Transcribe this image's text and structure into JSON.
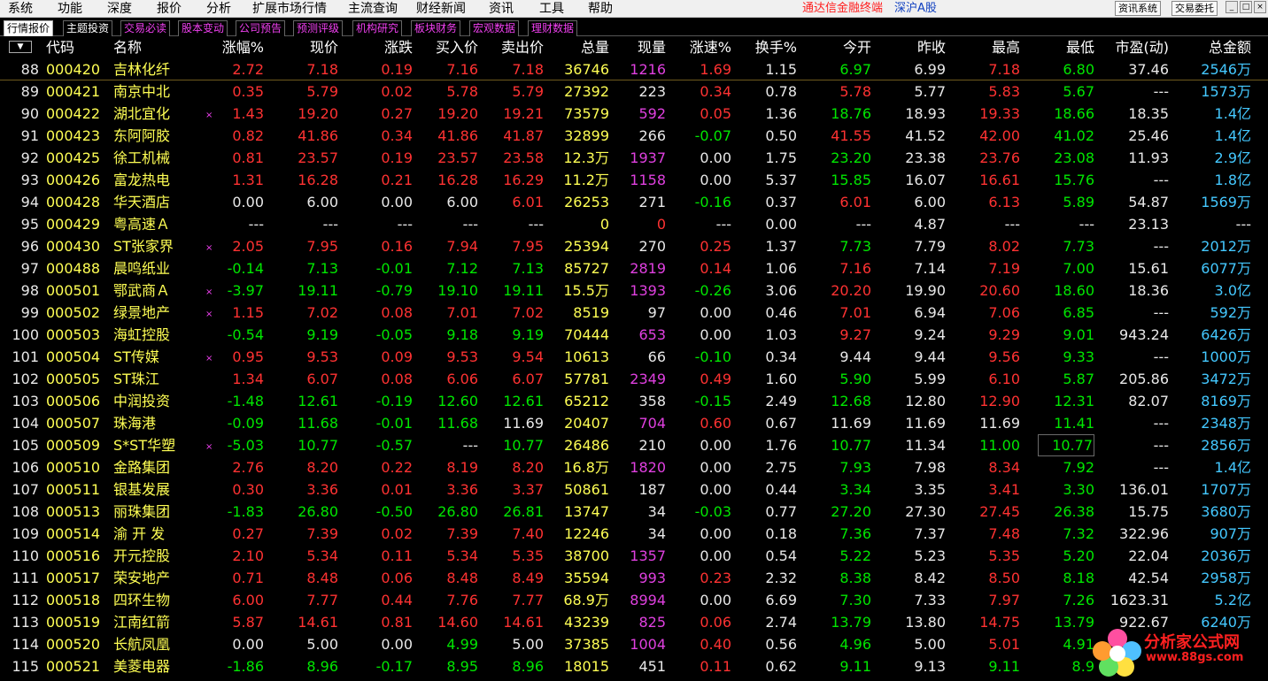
{
  "menu": {
    "items": [
      "系统",
      "功能",
      "深度",
      "报价",
      "分析",
      "扩展市场行情",
      "主流查询",
      "财经新闻",
      "资讯",
      "工具",
      "帮助"
    ],
    "app_status": "通达信金融终端",
    "market": "深沪A股",
    "buttons": [
      "资讯系统",
      "交易委托"
    ],
    "window_controls": [
      "_",
      "□",
      "×"
    ]
  },
  "tabs": [
    "行情报价",
    "主题投资",
    "交易必读",
    "股本变动",
    "公司预告",
    "预测评级",
    "机构研究",
    "板块财务",
    "宏观数据",
    "理财数据"
  ],
  "header": {
    "sort_icon": "▼",
    "columns": [
      "代码",
      "名称",
      "涨幅%",
      "现价",
      "涨跌",
      "买入价",
      "卖出价",
      "总量",
      "现量",
      "涨速%",
      "换手%",
      "今开",
      "昨收",
      "最高",
      "最低",
      "市盈(动)",
      "总金额"
    ]
  },
  "colors": {
    "up": "#ff3232",
    "down": "#00e600",
    "flat": "#e8e8e8",
    "code": "#ffff54",
    "amount": "#44c8ff",
    "volume_highlight": "#e040e0"
  },
  "rows": [
    {
      "idx": "88",
      "code": "000420",
      "name": "吉林化纤",
      "mark": false,
      "chg_pct": "2.72",
      "price": "7.18",
      "change": "0.19",
      "bid": "7.16",
      "ask": "7.18",
      "vol": "36746",
      "cur_vol": "1216",
      "speed": "1.69",
      "turnover": "1.15",
      "open": "6.97",
      "prev_close": "6.99",
      "high": "7.18",
      "low": "6.80",
      "pe": "37.46",
      "amount": "2546万"
    },
    {
      "idx": "89",
      "code": "000421",
      "name": "南京中北",
      "mark": false,
      "chg_pct": "0.35",
      "price": "5.79",
      "change": "0.02",
      "bid": "5.78",
      "ask": "5.79",
      "vol": "27392",
      "cur_vol": "223",
      "speed": "0.34",
      "turnover": "0.78",
      "open": "5.78",
      "prev_close": "5.77",
      "high": "5.83",
      "low": "5.67",
      "pe": "---",
      "amount": "1573万"
    },
    {
      "idx": "90",
      "code": "000422",
      "name": "湖北宜化",
      "mark": true,
      "chg_pct": "1.43",
      "price": "19.20",
      "change": "0.27",
      "bid": "19.20",
      "ask": "19.21",
      "vol": "73579",
      "cur_vol": "592",
      "speed": "0.05",
      "turnover": "1.36",
      "open": "18.76",
      "prev_close": "18.93",
      "high": "19.33",
      "low": "18.66",
      "pe": "18.35",
      "amount": "1.4亿"
    },
    {
      "idx": "91",
      "code": "000423",
      "name": "东阿阿胶",
      "mark": false,
      "chg_pct": "0.82",
      "price": "41.86",
      "change": "0.34",
      "bid": "41.86",
      "ask": "41.87",
      "vol": "32899",
      "cur_vol": "266",
      "speed": "-0.07",
      "turnover": "0.50",
      "open": "41.55",
      "prev_close": "41.52",
      "high": "42.00",
      "low": "41.02",
      "pe": "25.46",
      "amount": "1.4亿"
    },
    {
      "idx": "92",
      "code": "000425",
      "name": "徐工机械",
      "mark": false,
      "chg_pct": "0.81",
      "price": "23.57",
      "change": "0.19",
      "bid": "23.57",
      "ask": "23.58",
      "vol": "12.3万",
      "cur_vol": "1937",
      "speed": "0.00",
      "turnover": "1.75",
      "open": "23.20",
      "prev_close": "23.38",
      "high": "23.76",
      "low": "23.08",
      "pe": "11.93",
      "amount": "2.9亿"
    },
    {
      "idx": "93",
      "code": "000426",
      "name": "富龙热电",
      "mark": false,
      "chg_pct": "1.31",
      "price": "16.28",
      "change": "0.21",
      "bid": "16.28",
      "ask": "16.29",
      "vol": "11.2万",
      "cur_vol": "1158",
      "speed": "0.00",
      "turnover": "5.37",
      "open": "15.85",
      "prev_close": "16.07",
      "high": "16.61",
      "low": "15.76",
      "pe": "---",
      "amount": "1.8亿"
    },
    {
      "idx": "94",
      "code": "000428",
      "name": "华天酒店",
      "mark": false,
      "chg_pct": "0.00",
      "price": "6.00",
      "change": "0.00",
      "bid": "6.00",
      "ask": "6.01",
      "vol": "26253",
      "cur_vol": "271",
      "speed": "-0.16",
      "turnover": "0.37",
      "open": "6.01",
      "prev_close": "6.00",
      "high": "6.13",
      "low": "5.89",
      "pe": "54.87",
      "amount": "1569万"
    },
    {
      "idx": "95",
      "code": "000429",
      "name": "粤高速Ａ",
      "mark": false,
      "chg_pct": "---",
      "price": "---",
      "change": "---",
      "bid": "---",
      "ask": "---",
      "vol": "0",
      "cur_vol": "0",
      "speed": "---",
      "turnover": "0.00",
      "open": "---",
      "prev_close": "4.87",
      "high": "---",
      "low": "---",
      "pe": "23.13",
      "amount": "---"
    },
    {
      "idx": "96",
      "code": "000430",
      "name": "ST张家界",
      "mark": true,
      "chg_pct": "2.05",
      "price": "7.95",
      "change": "0.16",
      "bid": "7.94",
      "ask": "7.95",
      "vol": "25394",
      "cur_vol": "270",
      "speed": "0.25",
      "turnover": "1.37",
      "open": "7.73",
      "prev_close": "7.79",
      "high": "8.02",
      "low": "7.73",
      "pe": "---",
      "amount": "2012万"
    },
    {
      "idx": "97",
      "code": "000488",
      "name": "晨鸣纸业",
      "mark": false,
      "chg_pct": "-0.14",
      "price": "7.13",
      "change": "-0.01",
      "bid": "7.12",
      "ask": "7.13",
      "vol": "85727",
      "cur_vol": "2819",
      "speed": "0.14",
      "turnover": "1.06",
      "open": "7.16",
      "prev_close": "7.14",
      "high": "7.19",
      "low": "7.00",
      "pe": "15.61",
      "amount": "6077万"
    },
    {
      "idx": "98",
      "code": "000501",
      "name": "鄂武商Ａ",
      "mark": true,
      "chg_pct": "-3.97",
      "price": "19.11",
      "change": "-0.79",
      "bid": "19.10",
      "ask": "19.11",
      "vol": "15.5万",
      "cur_vol": "1393",
      "speed": "-0.26",
      "turnover": "3.06",
      "open": "20.20",
      "prev_close": "19.90",
      "high": "20.60",
      "low": "18.60",
      "pe": "18.36",
      "amount": "3.0亿"
    },
    {
      "idx": "99",
      "code": "000502",
      "name": "绿景地产",
      "mark": true,
      "chg_pct": "1.15",
      "price": "7.02",
      "change": "0.08",
      "bid": "7.01",
      "ask": "7.02",
      "vol": "8519",
      "cur_vol": "97",
      "speed": "0.00",
      "turnover": "0.46",
      "open": "7.01",
      "prev_close": "6.94",
      "high": "7.06",
      "low": "6.85",
      "pe": "---",
      "amount": "592万"
    },
    {
      "idx": "100",
      "code": "000503",
      "name": "海虹控股",
      "mark": false,
      "chg_pct": "-0.54",
      "price": "9.19",
      "change": "-0.05",
      "bid": "9.18",
      "ask": "9.19",
      "vol": "70444",
      "cur_vol": "653",
      "speed": "0.00",
      "turnover": "1.03",
      "open": "9.27",
      "prev_close": "9.24",
      "high": "9.29",
      "low": "9.01",
      "pe": "943.24",
      "amount": "6426万"
    },
    {
      "idx": "101",
      "code": "000504",
      "name": "ST传媒",
      "mark": true,
      "chg_pct": "0.95",
      "price": "9.53",
      "change": "0.09",
      "bid": "9.53",
      "ask": "9.54",
      "vol": "10613",
      "cur_vol": "66",
      "speed": "-0.10",
      "turnover": "0.34",
      "open": "9.44",
      "prev_close": "9.44",
      "high": "9.56",
      "low": "9.33",
      "pe": "---",
      "amount": "1000万"
    },
    {
      "idx": "102",
      "code": "000505",
      "name": "ST珠江",
      "mark": false,
      "chg_pct": "1.34",
      "price": "6.07",
      "change": "0.08",
      "bid": "6.06",
      "ask": "6.07",
      "vol": "57781",
      "cur_vol": "2349",
      "speed": "0.49",
      "turnover": "1.60",
      "open": "5.90",
      "prev_close": "5.99",
      "high": "6.10",
      "low": "5.87",
      "pe": "205.86",
      "amount": "3472万"
    },
    {
      "idx": "103",
      "code": "000506",
      "name": "中润投资",
      "mark": false,
      "chg_pct": "-1.48",
      "price": "12.61",
      "change": "-0.19",
      "bid": "12.60",
      "ask": "12.61",
      "vol": "65212",
      "cur_vol": "358",
      "speed": "-0.15",
      "turnover": "2.49",
      "open": "12.68",
      "prev_close": "12.80",
      "high": "12.90",
      "low": "12.31",
      "pe": "82.07",
      "amount": "8169万"
    },
    {
      "idx": "104",
      "code": "000507",
      "name": "珠海港",
      "mark": false,
      "chg_pct": "-0.09",
      "price": "11.68",
      "change": "-0.01",
      "bid": "11.68",
      "ask": "11.69",
      "vol": "20407",
      "cur_vol": "704",
      "speed": "0.60",
      "turnover": "0.67",
      "open": "11.69",
      "prev_close": "11.69",
      "high": "11.69",
      "low": "11.41",
      "pe": "---",
      "amount": "2348万"
    },
    {
      "idx": "105",
      "code": "000509",
      "name": "S*ST华塑",
      "mark": true,
      "chg_pct": "-5.03",
      "price": "10.77",
      "change": "-0.57",
      "bid": "---",
      "ask": "10.77",
      "vol": "26486",
      "cur_vol": "210",
      "speed": "0.00",
      "turnover": "1.76",
      "open": "10.77",
      "prev_close": "11.34",
      "high": "11.00",
      "low": "10.77",
      "pe": "---",
      "amount": "2856万"
    },
    {
      "idx": "106",
      "code": "000510",
      "name": "金路集团",
      "mark": false,
      "chg_pct": "2.76",
      "price": "8.20",
      "change": "0.22",
      "bid": "8.19",
      "ask": "8.20",
      "vol": "16.8万",
      "cur_vol": "1820",
      "speed": "0.00",
      "turnover": "2.75",
      "open": "7.93",
      "prev_close": "7.98",
      "high": "8.34",
      "low": "7.92",
      "pe": "---",
      "amount": "1.4亿"
    },
    {
      "idx": "107",
      "code": "000511",
      "name": "银基发展",
      "mark": false,
      "chg_pct": "0.30",
      "price": "3.36",
      "change": "0.01",
      "bid": "3.36",
      "ask": "3.37",
      "vol": "50861",
      "cur_vol": "187",
      "speed": "0.00",
      "turnover": "0.44",
      "open": "3.34",
      "prev_close": "3.35",
      "high": "3.41",
      "low": "3.30",
      "pe": "136.01",
      "amount": "1707万"
    },
    {
      "idx": "108",
      "code": "000513",
      "name": "丽珠集团",
      "mark": false,
      "chg_pct": "-1.83",
      "price": "26.80",
      "change": "-0.50",
      "bid": "26.80",
      "ask": "26.81",
      "vol": "13747",
      "cur_vol": "34",
      "speed": "-0.03",
      "turnover": "0.77",
      "open": "27.20",
      "prev_close": "27.30",
      "high": "27.45",
      "low": "26.38",
      "pe": "15.75",
      "amount": "3680万"
    },
    {
      "idx": "109",
      "code": "000514",
      "name": "渝 开 发",
      "mark": false,
      "chg_pct": "0.27",
      "price": "7.39",
      "change": "0.02",
      "bid": "7.39",
      "ask": "7.40",
      "vol": "12246",
      "cur_vol": "34",
      "speed": "0.00",
      "turnover": "0.18",
      "open": "7.36",
      "prev_close": "7.37",
      "high": "7.48",
      "low": "7.32",
      "pe": "322.96",
      "amount": "907万"
    },
    {
      "idx": "110",
      "code": "000516",
      "name": "开元控股",
      "mark": false,
      "chg_pct": "2.10",
      "price": "5.34",
      "change": "0.11",
      "bid": "5.34",
      "ask": "5.35",
      "vol": "38700",
      "cur_vol": "1357",
      "speed": "0.00",
      "turnover": "0.54",
      "open": "5.22",
      "prev_close": "5.23",
      "high": "5.35",
      "low": "5.20",
      "pe": "22.04",
      "amount": "2036万"
    },
    {
      "idx": "111",
      "code": "000517",
      "name": "荣安地产",
      "mark": false,
      "chg_pct": "0.71",
      "price": "8.48",
      "change": "0.06",
      "bid": "8.48",
      "ask": "8.49",
      "vol": "35594",
      "cur_vol": "993",
      "speed": "0.23",
      "turnover": "2.32",
      "open": "8.38",
      "prev_close": "8.42",
      "high": "8.50",
      "low": "8.18",
      "pe": "42.54",
      "amount": "2958万"
    },
    {
      "idx": "112",
      "code": "000518",
      "name": "四环生物",
      "mark": false,
      "chg_pct": "6.00",
      "price": "7.77",
      "change": "0.44",
      "bid": "7.76",
      "ask": "7.77",
      "vol": "68.9万",
      "cur_vol": "8994",
      "speed": "0.00",
      "turnover": "6.69",
      "open": "7.30",
      "prev_close": "7.33",
      "high": "7.97",
      "low": "7.26",
      "pe": "1623.31",
      "amount": "5.2亿"
    },
    {
      "idx": "113",
      "code": "000519",
      "name": "江南红箭",
      "mark": false,
      "chg_pct": "5.87",
      "price": "14.61",
      "change": "0.81",
      "bid": "14.60",
      "ask": "14.61",
      "vol": "43239",
      "cur_vol": "825",
      "speed": "0.06",
      "turnover": "2.74",
      "open": "13.79",
      "prev_close": "13.80",
      "high": "14.75",
      "low": "13.79",
      "pe": "922.67",
      "amount": "6240万"
    },
    {
      "idx": "114",
      "code": "000520",
      "name": "长航凤凰",
      "mark": false,
      "chg_pct": "0.00",
      "price": "5.00",
      "change": "0.00",
      "bid": "4.99",
      "ask": "5.00",
      "vol": "37385",
      "cur_vol": "1004",
      "speed": "0.40",
      "turnover": "0.56",
      "open": "4.96",
      "prev_close": "5.00",
      "high": "5.01",
      "low": "4.91",
      "pe": "",
      "amount": ""
    },
    {
      "idx": "115",
      "code": "000521",
      "name": "美菱电器",
      "mark": false,
      "chg_pct": "-1.86",
      "price": "8.96",
      "change": "-0.17",
      "bid": "8.95",
      "ask": "8.96",
      "vol": "18015",
      "cur_vol": "451",
      "speed": "0.11",
      "turnover": "0.62",
      "open": "9.11",
      "prev_close": "9.13",
      "high": "9.11",
      "low": "8.9",
      "pe": "",
      "amount": ""
    }
  ],
  "watermark": {
    "title": "分析家公式网",
    "url": "www.88gs.com"
  }
}
